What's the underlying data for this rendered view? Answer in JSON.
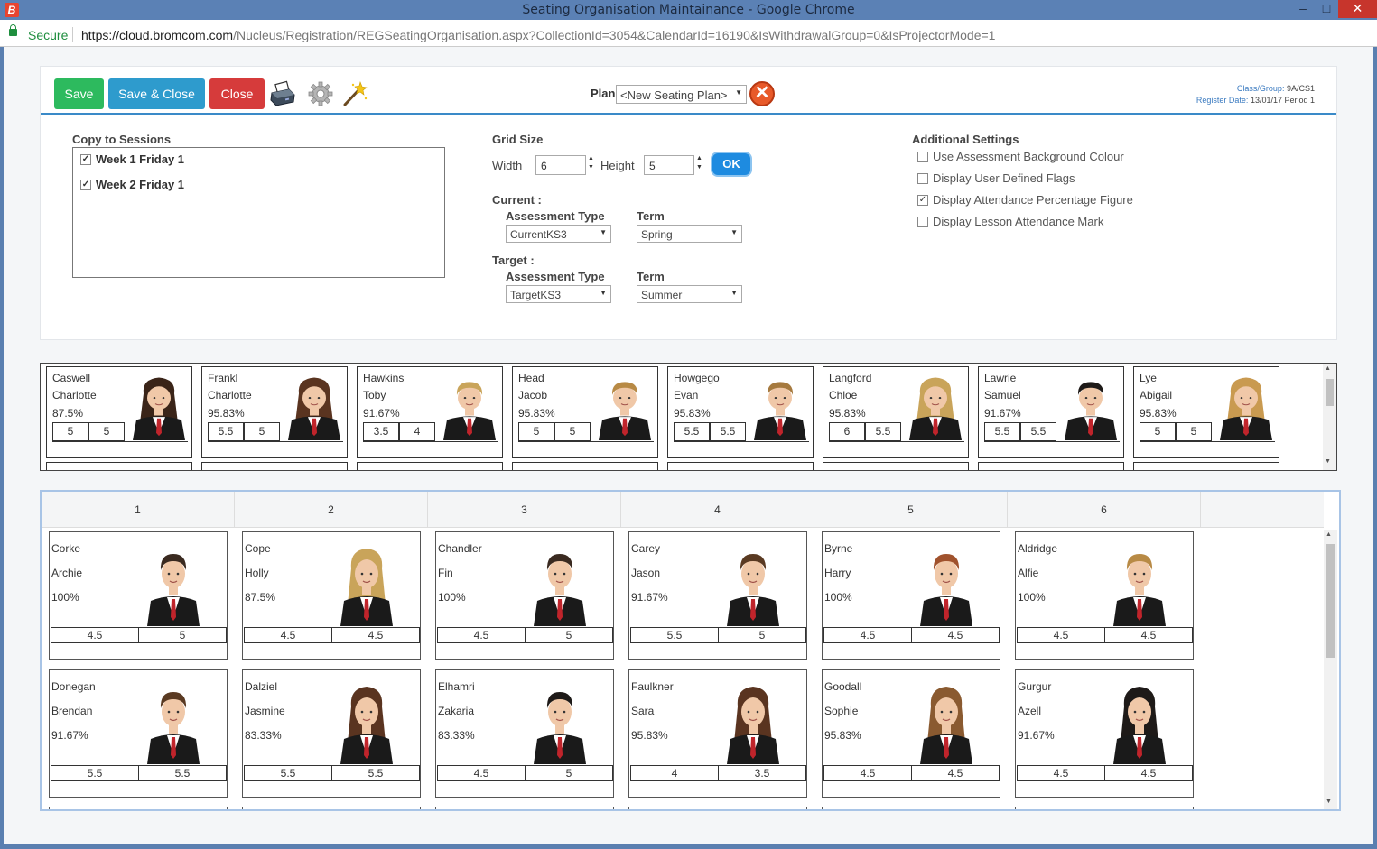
{
  "window": {
    "app_icon": "B",
    "title": "Seating Organisation Maintainance - Google Chrome",
    "minimize": "–",
    "maximize": "□",
    "close": "✕"
  },
  "address_bar": {
    "secure_label": "Secure",
    "url_origin": "https://cloud.bromcom.com",
    "url_path": "/Nucleus/Registration/REGSeatingOrganisation.aspx?CollectionId=3054&CalendarId=16190&IsWithdrawalGroup=0&IsProjectorMode=1"
  },
  "toolbar": {
    "save_label": "Save",
    "save_close_label": "Save & Close",
    "close_label": "Close",
    "icons": [
      "printer-icon",
      "gear-icon",
      "magic-wand-icon"
    ],
    "plan_label": "Plan",
    "plan_value": "<New Seating Plan>",
    "delete_plan_glyph": "✕"
  },
  "class_info": {
    "class_group_label": "Class/Group:",
    "class_group_value": "9A/CS1",
    "register_date_label": "Register Date:",
    "register_date_value": "13/01/17 Period 1"
  },
  "copy_to_sessions": {
    "title": "Copy to Sessions",
    "items": [
      {
        "label": "Week 1 Friday 1",
        "checked": true
      },
      {
        "label": "Week 2 Friday 1",
        "checked": true
      }
    ]
  },
  "grid_size": {
    "title": "Grid Size",
    "width_label": "Width",
    "width_value": "6",
    "height_label": "Height",
    "height_value": "5",
    "ok_label": "OK"
  },
  "current": {
    "title": "Current :",
    "assessment_type_label": "Assessment Type",
    "assessment_type_value": "CurrentKS3",
    "term_label": "Term",
    "term_value": "Spring"
  },
  "target": {
    "title": "Target :",
    "assessment_type_label": "Assessment Type",
    "assessment_type_value": "TargetKS3",
    "term_label": "Term",
    "term_value": "Summer"
  },
  "additional_settings": {
    "title": "Additional Settings",
    "items": [
      {
        "label": "Use Assessment Background Colour",
        "checked": false
      },
      {
        "label": "Display User Defined Flags",
        "checked": false
      },
      {
        "label": "Display Attendance Percentage Figure",
        "checked": true
      },
      {
        "label": "Display Lesson Attendance Mark",
        "checked": false
      }
    ]
  },
  "unplaced_students": [
    {
      "surname": "Caswell",
      "forename": "Charlotte",
      "attendance": "87.5%",
      "current": "5",
      "target": "5",
      "gender": "f",
      "hair": "#3a2418"
    },
    {
      "surname": "Frankl",
      "forename": "Charlotte",
      "attendance": "95.83%",
      "current": "5.5",
      "target": "5",
      "gender": "f",
      "hair": "#5a3420"
    },
    {
      "surname": "Hawkins",
      "forename": "Toby",
      "attendance": "91.67%",
      "current": "3.5",
      "target": "4",
      "gender": "m",
      "hair": "#c9a45a"
    },
    {
      "surname": "Head",
      "forename": "Jacob",
      "attendance": "95.83%",
      "current": "5",
      "target": "5",
      "gender": "m",
      "hair": "#b88a45"
    },
    {
      "surname": "Howgego",
      "forename": "Evan",
      "attendance": "95.83%",
      "current": "5.5",
      "target": "5.5",
      "gender": "m",
      "hair": "#a67a3f"
    },
    {
      "surname": "Langford",
      "forename": "Chloe",
      "attendance": "95.83%",
      "current": "6",
      "target": "5.5",
      "gender": "f",
      "hair": "#c9a45a"
    },
    {
      "surname": "Lawrie",
      "forename": "Samuel",
      "attendance": "91.67%",
      "current": "5.5",
      "target": "5.5",
      "gender": "m",
      "hair": "#1e1a18"
    },
    {
      "surname": "Lye",
      "forename": "Abigail",
      "attendance": "95.83%",
      "current": "5",
      "target": "5",
      "gender": "f",
      "hair": "#c99a50"
    }
  ],
  "seating_grid": {
    "columns": [
      "1",
      "2",
      "3",
      "4",
      "5",
      "6"
    ],
    "rows": [
      [
        {
          "surname": "Corke",
          "forename": "Archie",
          "attendance": "100%",
          "current": "4.5",
          "target": "5",
          "gender": "m",
          "hair": "#3a2a20"
        },
        {
          "surname": "Cope",
          "forename": "Holly",
          "attendance": "87.5%",
          "current": "4.5",
          "target": "4.5",
          "gender": "f",
          "hair": "#c9a45a"
        },
        {
          "surname": "Chandler",
          "forename": "Fin",
          "attendance": "100%",
          "current": "4.5",
          "target": "5",
          "gender": "m",
          "hair": "#3a2a20"
        },
        {
          "surname": "Carey",
          "forename": "Jason",
          "attendance": "91.67%",
          "current": "5.5",
          "target": "5",
          "gender": "m",
          "hair": "#5a3a22"
        },
        {
          "surname": "Byrne",
          "forename": "Harry",
          "attendance": "100%",
          "current": "4.5",
          "target": "4.5",
          "gender": "m",
          "hair": "#a0522d"
        },
        {
          "surname": "Aldridge",
          "forename": "Alfie",
          "attendance": "100%",
          "current": "4.5",
          "target": "4.5",
          "gender": "m",
          "hair": "#b88a45"
        }
      ],
      [
        {
          "surname": "Donegan",
          "forename": "Brendan",
          "attendance": "91.67%",
          "current": "5.5",
          "target": "5.5",
          "gender": "m",
          "hair": "#5a3a22"
        },
        {
          "surname": "Dalziel",
          "forename": "Jasmine",
          "attendance": "83.33%",
          "current": "5.5",
          "target": "5.5",
          "gender": "f",
          "hair": "#5a3420"
        },
        {
          "surname": "Elhamri",
          "forename": "Zakaria",
          "attendance": "83.33%",
          "current": "4.5",
          "target": "5",
          "gender": "m",
          "hair": "#1e1a18"
        },
        {
          "surname": "Faulkner",
          "forename": "Sara",
          "attendance": "95.83%",
          "current": "4",
          "target": "3.5",
          "gender": "f",
          "hair": "#5a3420"
        },
        {
          "surname": "Goodall",
          "forename": "Sophie",
          "attendance": "95.83%",
          "current": "4.5",
          "target": "4.5",
          "gender": "f",
          "hair": "#8a5a30"
        },
        {
          "surname": "Gurgur",
          "forename": "Azell",
          "attendance": "91.67%",
          "current": "4.5",
          "target": "4.5",
          "gender": "f",
          "hair": "#1e1a18"
        }
      ]
    ]
  },
  "colors": {
    "save": "#2dba5e",
    "save_close": "#2e9bcd",
    "close": "#d63b3b",
    "ok": "#1e8be0",
    "blazer": "#1a1a1a",
    "tie": "#c0242b",
    "skin": "#f0c8a8"
  }
}
